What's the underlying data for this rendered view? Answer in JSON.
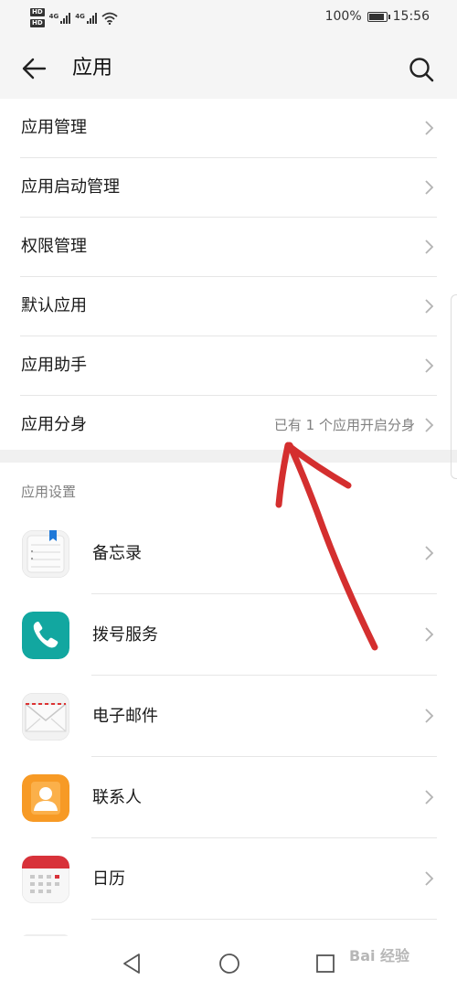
{
  "status_bar": {
    "hd_badge": "HD",
    "network": "4G",
    "battery_percent": "100%",
    "battery_level": 1.0,
    "time": "15:56"
  },
  "header": {
    "title": "应用",
    "back_icon": "arrow-left-icon",
    "search_icon": "search-icon"
  },
  "group1": {
    "items": [
      {
        "label": "应用管理",
        "value": ""
      },
      {
        "label": "应用启动管理",
        "value": ""
      },
      {
        "label": "权限管理",
        "value": ""
      },
      {
        "label": "默认应用",
        "value": ""
      },
      {
        "label": "应用助手",
        "value": ""
      },
      {
        "label": "应用分身",
        "value": "已有 1 个应用开启分身"
      }
    ]
  },
  "section_title": "应用设置",
  "apps": {
    "items": [
      {
        "label": "备忘录",
        "icon": "memo-icon"
      },
      {
        "label": "拨号服务",
        "icon": "phone-icon"
      },
      {
        "label": "电子邮件",
        "icon": "mail-icon"
      },
      {
        "label": "联系人",
        "icon": "contacts-icon"
      },
      {
        "label": "日历",
        "icon": "calendar-icon"
      }
    ]
  },
  "watermark": "Bai 经验",
  "colors": {
    "accent_teal": "#12a7a0",
    "contacts_orange": "#f79a25",
    "calendar_red": "#d8323a",
    "annotation_red": "#d42f2f"
  }
}
